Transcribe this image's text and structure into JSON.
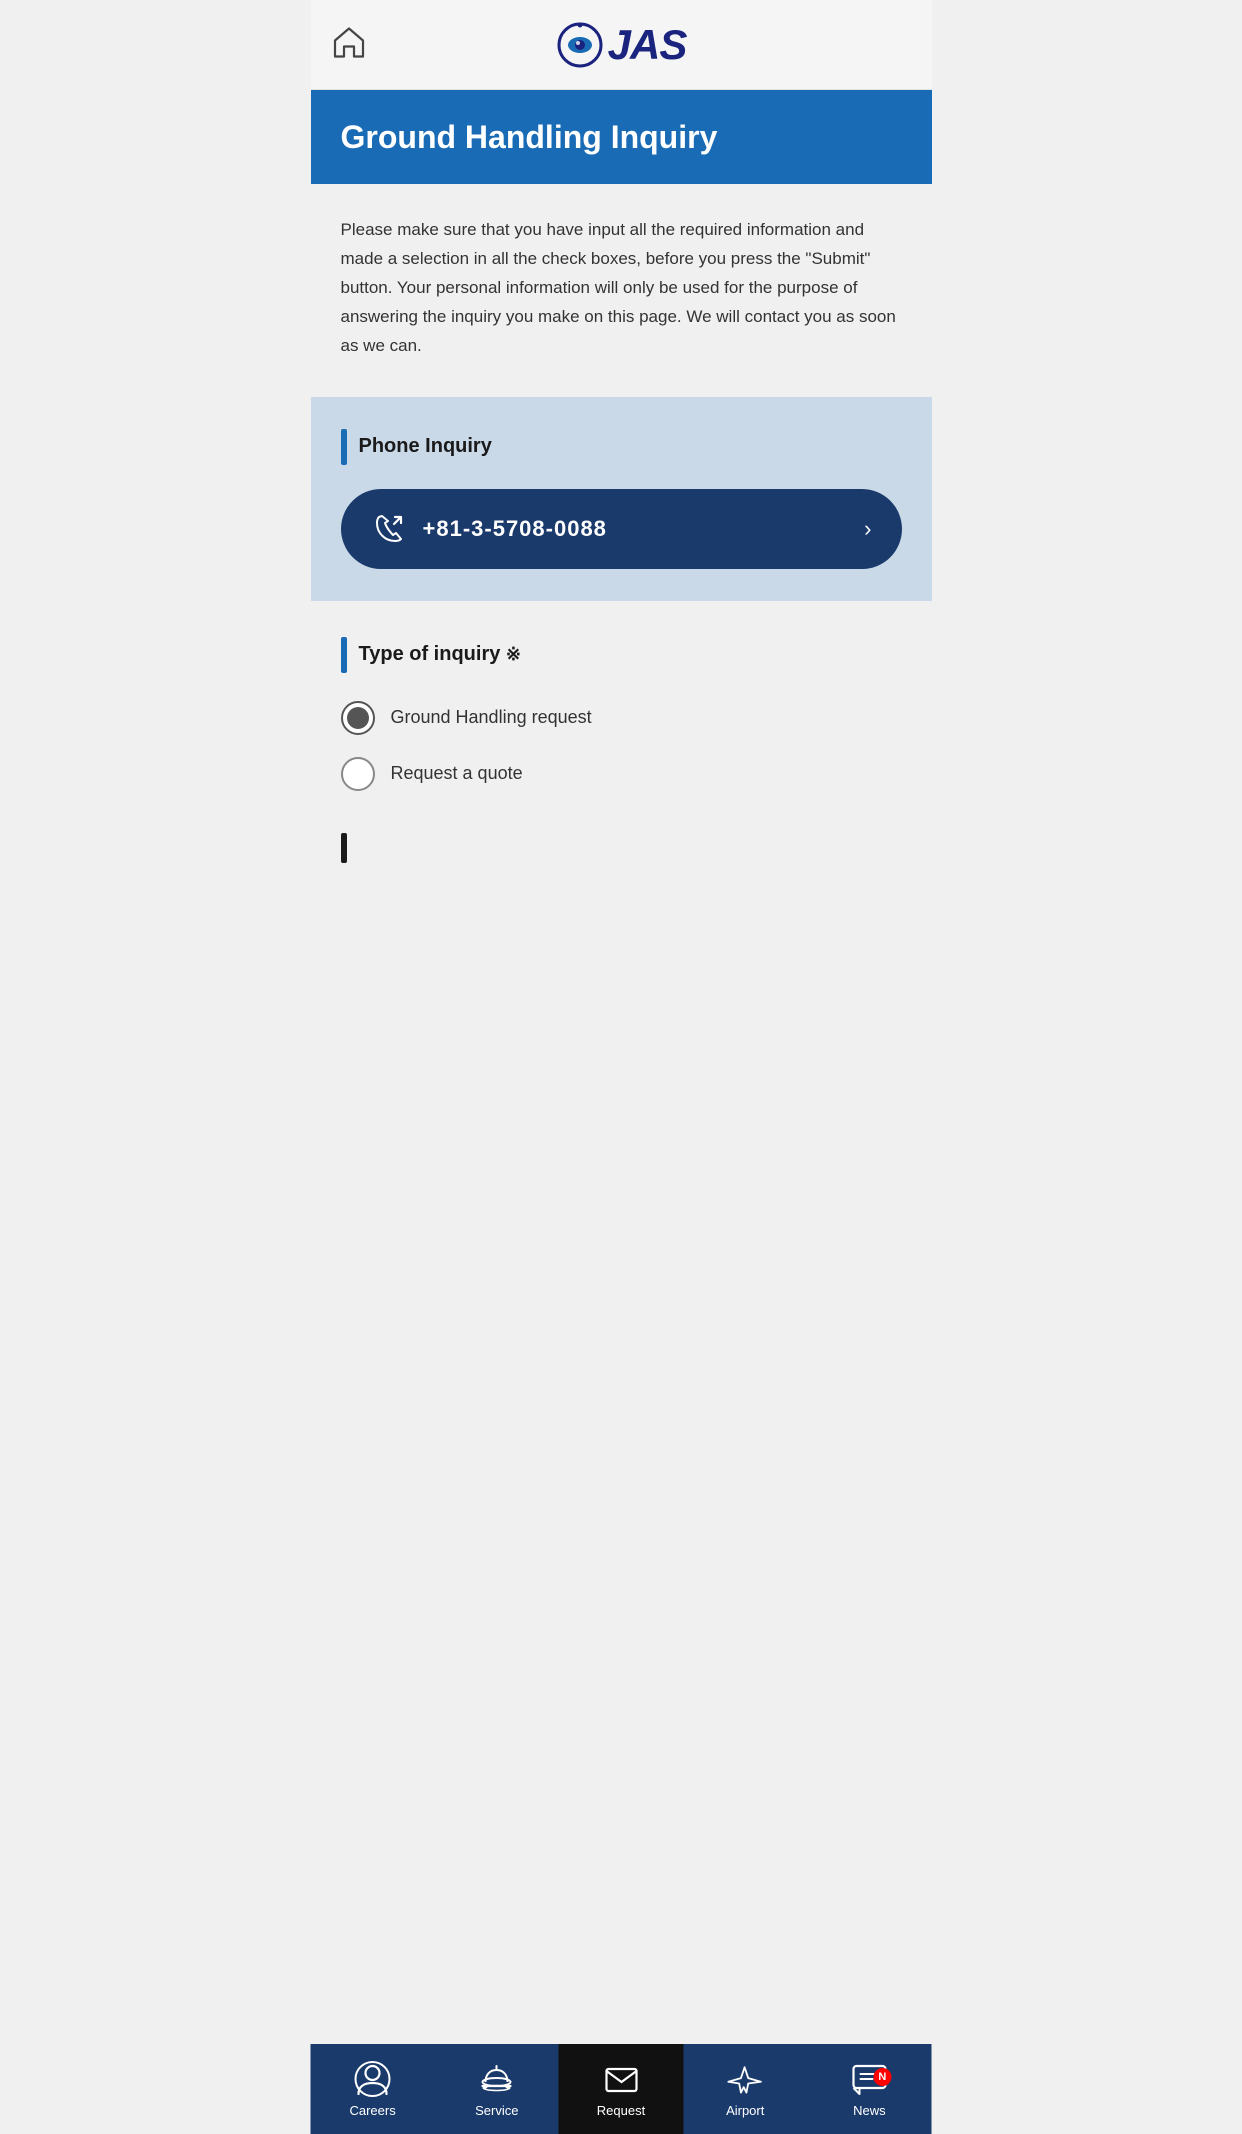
{
  "header": {
    "home_label": "Home"
  },
  "page": {
    "title": "Ground Handling Inquiry",
    "info_text": "Please make sure that you have input all the required information and made a selection in all the check boxes, before you press the \"Submit\" button. Your personal information will only be used for the purpose of answering the inquiry you make on this page. We will contact you as soon as we can."
  },
  "phone_section": {
    "heading": "Phone Inquiry",
    "phone_number": "+81-3-5708-0088"
  },
  "inquiry_section": {
    "heading": "Type of inquiry",
    "asterisk": "※",
    "options": [
      {
        "label": "Ground Handling request",
        "selected": true
      },
      {
        "label": "Request a quote",
        "selected": false
      }
    ]
  },
  "bottom_nav": {
    "items": [
      {
        "id": "careers",
        "label": "Careers",
        "active": false,
        "badge": null
      },
      {
        "id": "service",
        "label": "Service",
        "active": false,
        "badge": null
      },
      {
        "id": "request",
        "label": "Request",
        "active": true,
        "badge": null
      },
      {
        "id": "airport",
        "label": "Airport",
        "active": false,
        "badge": null
      },
      {
        "id": "news",
        "label": "News",
        "active": false,
        "badge": "N"
      }
    ]
  }
}
